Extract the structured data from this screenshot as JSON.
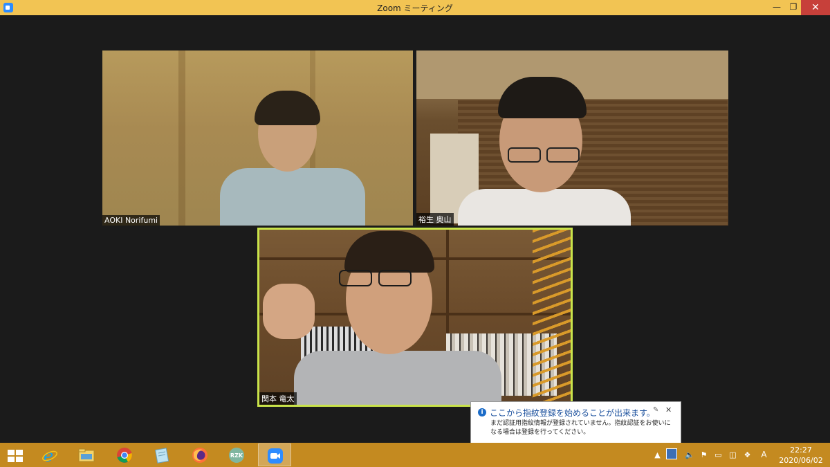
{
  "window": {
    "title": "Zoom ミーティング"
  },
  "participants": [
    {
      "name": "AOKI Norifumi"
    },
    {
      "name": "裕生 奥山"
    },
    {
      "name": "関本 竜太"
    }
  ],
  "notification": {
    "title": "ここから指紋登録を始めることが出来ます。",
    "body": "まだ認証用指紋情報が登録されていません。指紋認証をお使いになる場合は登録を行ってください。"
  },
  "taskbar": {
    "pinned": [
      "start-icon",
      "internet-explorer-icon",
      "file-explorer-icon",
      "chrome-icon",
      "notepad-icon",
      "firefox-icon",
      "rzk-app-icon",
      "zoom-icon"
    ],
    "active": "zoom-icon",
    "rzk_label": "RZK"
  },
  "tray": {
    "ime_label": "A",
    "time": "22:27",
    "date": "2020/06/02"
  },
  "colors": {
    "titlebar": "#f2c453",
    "taskbar": "#c48a20",
    "active_speaker_border": "#c9e34a"
  }
}
